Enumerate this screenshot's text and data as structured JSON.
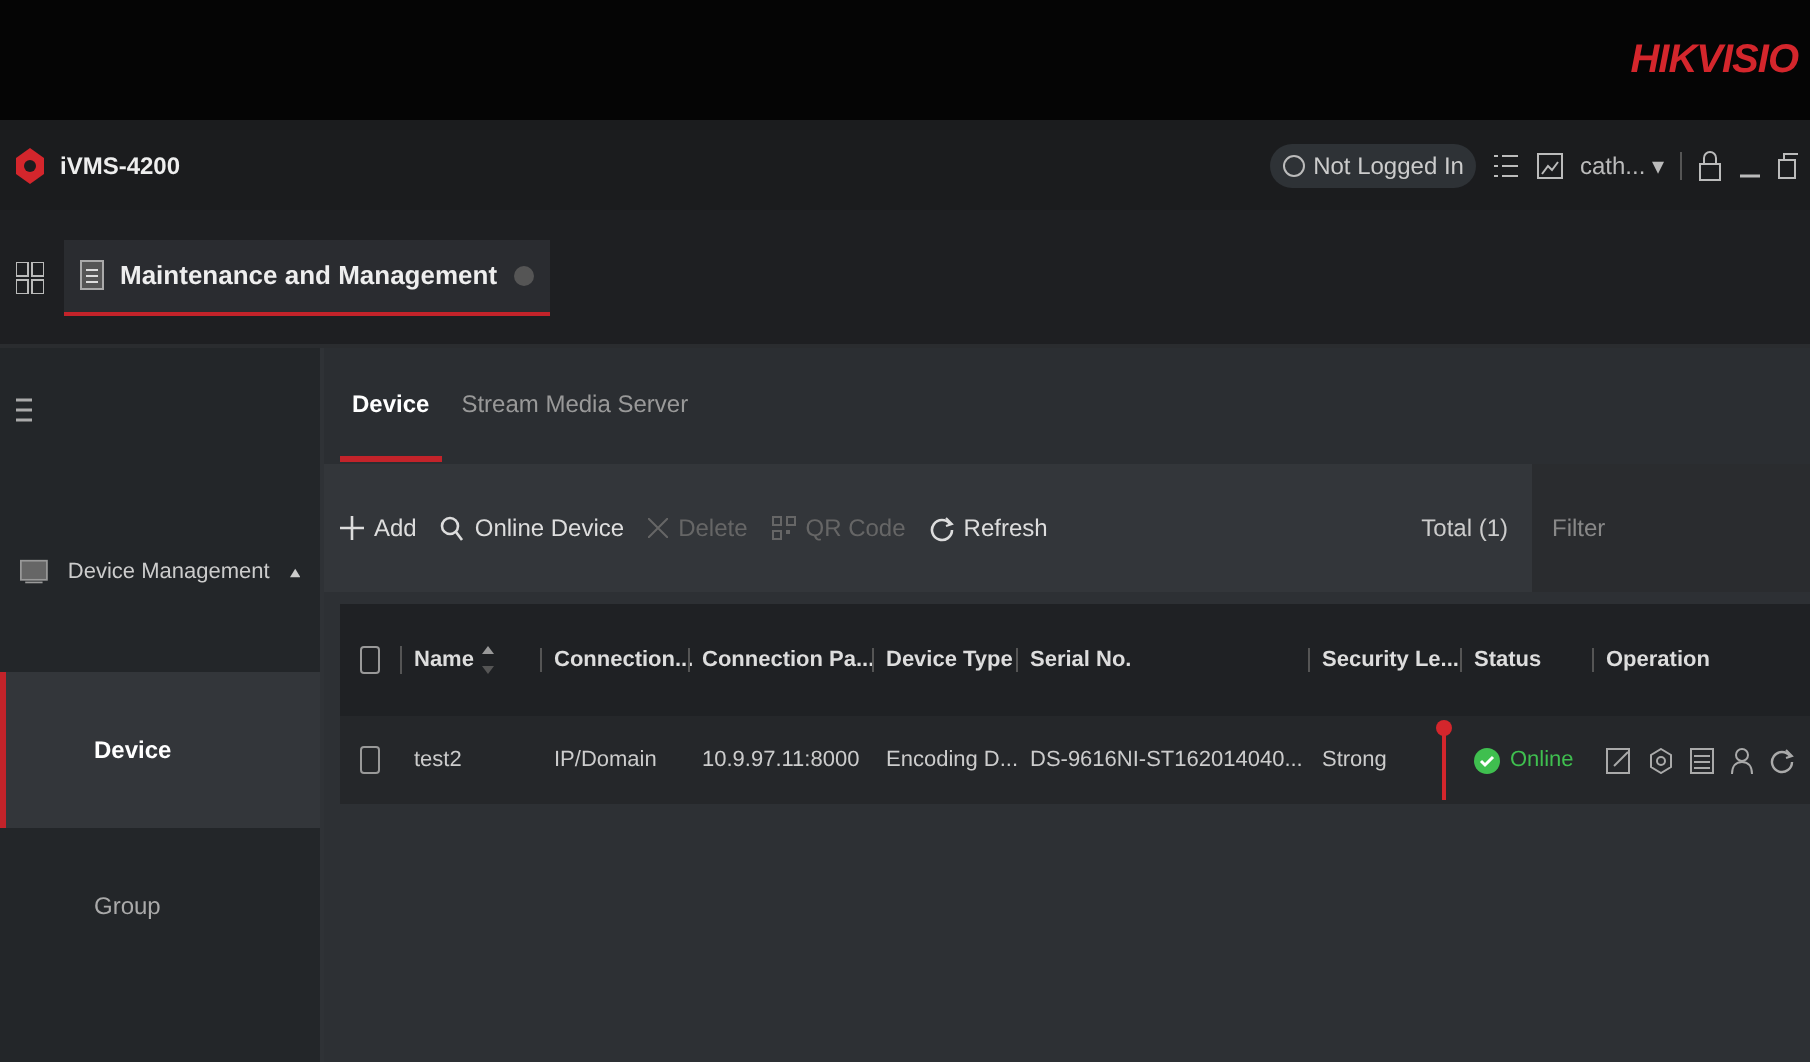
{
  "brand_bar": {
    "logo": "HIKVISIO"
  },
  "title_bar": {
    "app_name": "iVMS-4200",
    "login_status": "Not Logged In",
    "user": "cath...",
    "user_menu_caret": "▾"
  },
  "module_tabs": [
    {
      "label": "Maintenance and Management",
      "selected": true
    }
  ],
  "sidebar": {
    "items": [
      {
        "label": "Device Management",
        "expanded": true,
        "children": [
          {
            "label": "Device",
            "selected": true
          },
          {
            "label": "Group",
            "selected": false
          }
        ]
      }
    ]
  },
  "sub_tabs": [
    {
      "label": "Device",
      "selected": true
    },
    {
      "label": "Stream Media Server",
      "selected": false
    }
  ],
  "toolbar": {
    "buttons": [
      {
        "kind": "add",
        "label": "Add",
        "disabled": false
      },
      {
        "kind": "search",
        "label": "Online Device",
        "disabled": false
      },
      {
        "kind": "delete",
        "label": "Delete",
        "disabled": true
      },
      {
        "kind": "qr",
        "label": "QR Code",
        "disabled": true
      },
      {
        "kind": "refresh",
        "label": "Refresh",
        "disabled": false
      }
    ],
    "total": "Total (1)",
    "filter": {
      "placeholder": "Filter"
    }
  },
  "table": {
    "select_all_checked": false,
    "columns": [
      "Name",
      "Connection...",
      "Connection Pa...",
      "Device Type",
      "Serial No.",
      "Security Le...",
      "Status",
      "Operation"
    ],
    "rows": [
      {
        "checked": false,
        "cells": [
          "test2",
          "IP/Domain",
          "10.9.97.11:8000",
          "Encoding D...",
          "DS-9616NI-ST162014040...",
          "Strong",
          "Online",
          ""
        ],
        "color": "#3fbf4f"
      }
    ]
  }
}
